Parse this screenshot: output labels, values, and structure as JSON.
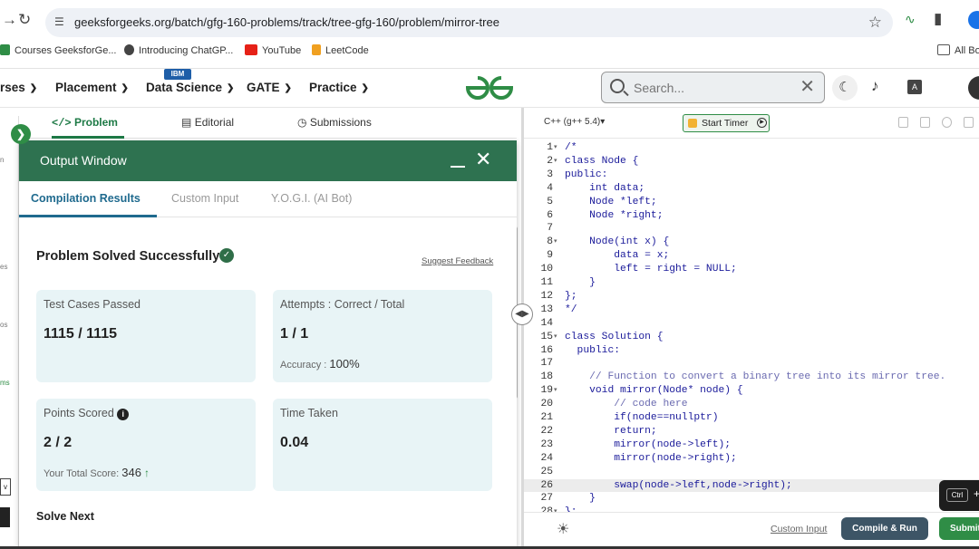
{
  "browser": {
    "url": "geeksforgeeks.org/batch/gfg-160-problems/track/tree-gfg-160/problem/mirror-tree",
    "bookmarks": [
      "Courses GeeksforGe...",
      "Introducing ChatGP...",
      "YouTube",
      "LeetCode"
    ],
    "all_bookmarks": "All Bo"
  },
  "sitenav": {
    "items": [
      "rses",
      "Placement",
      "Data Science",
      "GATE",
      "Practice"
    ],
    "badge": "IBM",
    "search_placeholder": "Search..."
  },
  "problem_tabs": [
    "Problem",
    "Editorial",
    "Submissions"
  ],
  "left_strip": [
    "n",
    "es",
    "os",
    "ms",
    "v"
  ],
  "output_window": {
    "title": "Output Window",
    "tabs": [
      "Compilation Results",
      "Custom Input",
      "Y.O.G.I. (AI Bot)"
    ],
    "status": "Problem Solved Successfully",
    "suggest_feedback": "Suggest Feedback",
    "cards": {
      "test_cases": {
        "label": "Test Cases Passed",
        "value": "1115 / 1115"
      },
      "attempts": {
        "label": "Attempts : Correct / Total",
        "value": "1 / 1",
        "sub_label": "Accuracy :",
        "sub_value": "100%"
      },
      "points": {
        "label": "Points Scored",
        "value": "2 / 2",
        "sub_label": "Your Total Score:",
        "sub_value": "346"
      },
      "time": {
        "label": "Time Taken",
        "value": "0.04"
      }
    },
    "solve_next": "Solve Next"
  },
  "editor": {
    "language": "C++ (g++ 5.4)",
    "timer_label": "Start Timer",
    "custom_input": "Custom Input",
    "compile_run": "Compile & Run",
    "submit": "Submit",
    "tooltip_key": "Ctrl",
    "tooltip_plus": "+",
    "current_line": 26,
    "lines": [
      {
        "n": 1,
        "fold": true,
        "text": "/*"
      },
      {
        "n": 2,
        "fold": true,
        "text": "class Node {"
      },
      {
        "n": 3,
        "fold": false,
        "text": "public:"
      },
      {
        "n": 4,
        "fold": false,
        "text": "    int data;"
      },
      {
        "n": 5,
        "fold": false,
        "text": "    Node *left;"
      },
      {
        "n": 6,
        "fold": false,
        "text": "    Node *right;"
      },
      {
        "n": 7,
        "fold": false,
        "text": ""
      },
      {
        "n": 8,
        "fold": true,
        "text": "    Node(int x) {"
      },
      {
        "n": 9,
        "fold": false,
        "text": "        data = x;"
      },
      {
        "n": 10,
        "fold": false,
        "text": "        left = right = NULL;"
      },
      {
        "n": 11,
        "fold": false,
        "text": "    }"
      },
      {
        "n": 12,
        "fold": false,
        "text": "};"
      },
      {
        "n": 13,
        "fold": false,
        "text": "*/"
      },
      {
        "n": 14,
        "fold": false,
        "text": ""
      },
      {
        "n": 15,
        "fold": true,
        "text": "class Solution {"
      },
      {
        "n": 16,
        "fold": false,
        "text": "  public:"
      },
      {
        "n": 17,
        "fold": false,
        "text": ""
      },
      {
        "n": 18,
        "fold": false,
        "text": "    // Function to convert a binary tree into its mirror tree."
      },
      {
        "n": 19,
        "fold": true,
        "text": "    void mirror(Node* node) {"
      },
      {
        "n": 20,
        "fold": false,
        "text": "        // code here"
      },
      {
        "n": 21,
        "fold": false,
        "text": "        if(node==nullptr)"
      },
      {
        "n": 22,
        "fold": false,
        "text": "        return;"
      },
      {
        "n": 23,
        "fold": false,
        "text": "        mirror(node->left);"
      },
      {
        "n": 24,
        "fold": false,
        "text": "        mirror(node->right);"
      },
      {
        "n": 25,
        "fold": false,
        "text": ""
      },
      {
        "n": 26,
        "fold": false,
        "text": "        swap(node->left,node->right);"
      },
      {
        "n": 27,
        "fold": false,
        "text": "    }"
      },
      {
        "n": 28,
        "fold": true,
        "text": "};"
      }
    ]
  },
  "colors": {
    "brand": "#2f8d46",
    "header": "#2e7250",
    "tab_accent": "#1f6a8e",
    "code": "#1a1a9a"
  }
}
